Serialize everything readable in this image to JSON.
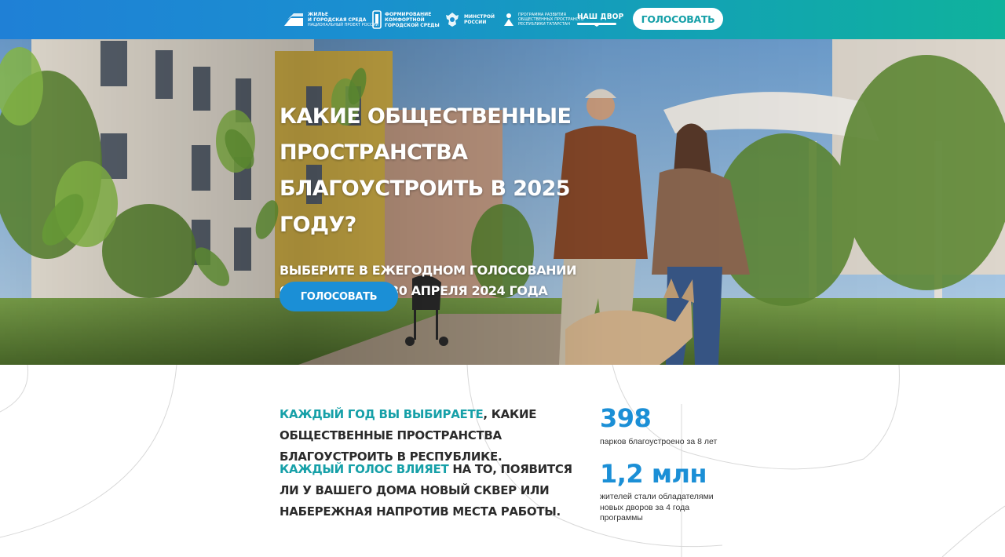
{
  "header": {
    "logos": {
      "zhilye": "ЖИЛЬЕ\nИ ГОРОДСКАЯ СРЕДА",
      "zhilye_sub": "национальный проект россии",
      "formirovanie": "ФОРМИРОВАНИЕ\nКОМФОРТНОЙ\nГОРОДСКОЙ СРЕДЫ",
      "minstroy": "МИНСТРОЙ\nРОССИИ",
      "programma": "Программа развития\nобщественных пространств\nРеспублики Татарстан",
      "nashdvor": "НАШ ДВОР"
    },
    "vote_label": "ГОЛОСОВАТЬ"
  },
  "hero": {
    "title": "КАКИЕ ОБЩЕСТВЕННЫЕ ПРОСТРАНСТВА БЛАГОУСТРОИТЬ В 2025 ГОДУ?",
    "title_lines": [
      "КАКИЕ ОБЩЕСТВЕННЫЕ",
      "ПРОСТРАНСТВА",
      "БЛАГОУСТРОИТЬ В 2025 ГОДУ?"
    ],
    "subtitle_lines": [
      "ВЫБЕРИТЕ В ЕЖЕГОДНОМ ГОЛОСОВАНИИ",
      "С 15 МАРТА ПО 30 АПРЕЛЯ 2024 ГОДА"
    ],
    "vote_label": "ГОЛОСОВАТЬ"
  },
  "info": {
    "paragraph_1": {
      "accent": "КАЖДЫЙ ГОД ВЫ ВЫБИРАЕТЕ",
      "rest": ", КАКИЕ ОБЩЕСТВЕННЫЕ ПРОСТРАНСТВА БЛАГОУСТРОИТЬ В РЕСПУБЛИКЕ."
    },
    "paragraph_2": {
      "accent": "КАЖДЫЙ ГОЛОС ВЛИЯЕТ",
      "rest": " НА ТО, ПОЯВИТСЯ ЛИ У ВАШЕГО ДОМА НОВЫЙ СКВЕР ИЛИ НАБЕРЕЖНАЯ НАПРОТИВ МЕСТА РАБОТЫ."
    },
    "stats": [
      {
        "value": "398",
        "caption": "парков благоустроено за 8 лет"
      },
      {
        "value": "1,2 млн",
        "caption": "жителей стали обладателями новых дворов за 4 года программы"
      }
    ]
  },
  "colors": {
    "header_gradient_start": "#1f80d6",
    "header_gradient_end": "#0fb29c",
    "accent_teal": "#16a0a8",
    "accent_blue": "#1b8fd6",
    "text_dark": "#2b2b2b"
  },
  "icons": [
    "zhilye-logo-icon",
    "formirovanie-logo-icon",
    "minstroy-emblem-icon",
    "programma-logo-icon",
    "nashdvor-logo-icon"
  ]
}
